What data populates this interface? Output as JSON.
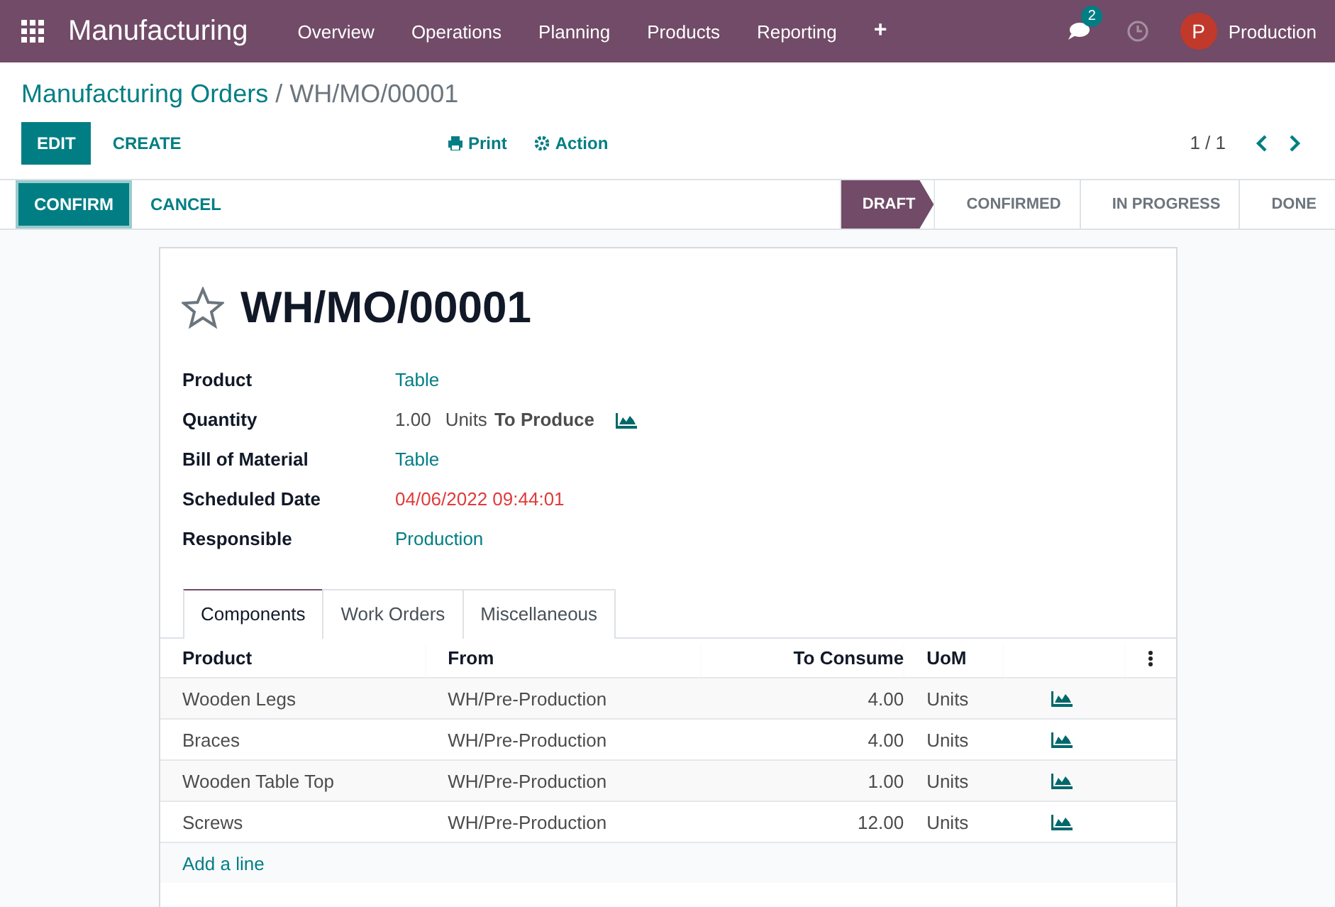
{
  "navbar": {
    "app": "Manufacturing",
    "menu": [
      "Overview",
      "Operations",
      "Planning",
      "Products",
      "Reporting",
      "+"
    ],
    "messages_count": "2",
    "user_initial": "P",
    "user": "Production"
  },
  "breadcrumb": {
    "parent": "Manufacturing Orders",
    "separator": "/",
    "current": "WH/MO/00001"
  },
  "control_panel": {
    "buttons": [
      "EDIT",
      "CREATE"
    ],
    "actions": [
      "Print",
      "Action"
    ],
    "pager": "1 / 1"
  },
  "statusbar": {
    "buttons": [
      "CONFIRM",
      "CANCEL"
    ],
    "steps": [
      {
        "label": "DRAFT",
        "selected": true
      },
      {
        "label": "CONFIRMED",
        "selected": false
      },
      {
        "label": "IN PROGRESS",
        "selected": false
      },
      {
        "label": "DONE",
        "selected": false
      }
    ]
  },
  "form": {
    "title": "WH/MO/00001",
    "starred": false,
    "fields": [
      {
        "kind": "link",
        "label": "Product",
        "value": "Table"
      },
      {
        "kind": "quantity",
        "label": "Quantity",
        "value": "1.00",
        "unit": "Units",
        "suffix": "To Produce"
      },
      {
        "kind": "link",
        "label": "Bill of Material",
        "value": "Table"
      },
      {
        "kind": "date",
        "label": "Scheduled Date",
        "value": "04/06/2022 09:44:01",
        "overdue": true
      },
      {
        "kind": "link",
        "label": "Responsible",
        "value": "Production"
      }
    ],
    "tabs": [
      {
        "label": "Components",
        "selected": true
      },
      {
        "label": "Work Orders",
        "selected": false
      },
      {
        "label": "Miscellaneous",
        "selected": false
      }
    ],
    "table": {
      "columns": [
        "Product",
        "From",
        "To Consume",
        "UoM"
      ],
      "rows": [
        {
          "product": "Wooden Legs",
          "from": "WH/Pre-Production",
          "to_consume": "4.00",
          "uom": "Units"
        },
        {
          "product": "Braces",
          "from": "WH/Pre-Production",
          "to_consume": "4.00",
          "uom": "Units"
        },
        {
          "product": "Wooden Table Top",
          "from": "WH/Pre-Production",
          "to_consume": "1.00",
          "uom": "Units"
        },
        {
          "product": "Screws",
          "from": "WH/Pre-Production",
          "to_consume": "12.00",
          "uom": "Units"
        }
      ],
      "add_line": "Add a line"
    }
  }
}
